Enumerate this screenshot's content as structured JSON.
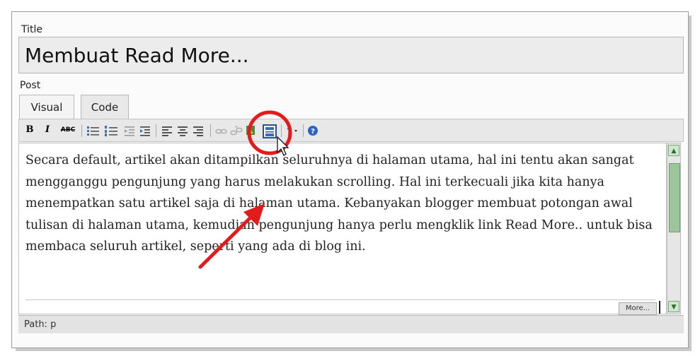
{
  "form": {
    "title_label": "Title",
    "title_value": "Membuat Read More...",
    "post_label": "Post",
    "tabs": [
      {
        "label": "Visual"
      },
      {
        "label": "Code"
      }
    ]
  },
  "toolbar": {
    "bold": "B",
    "italic": "I",
    "strikethrough": "ABC"
  },
  "editor": {
    "content": "Secara default, artikel akan ditampilkan seluruhnya di halaman utama, hal ini tentu akan sangat mengganggu pengunjung yang harus melakukan scrolling. Hal ini terkecuali jika kita hanya menempatkan satu artikel saja di halaman utama. Kebanyakan blogger membuat potongan awal tulisan di halaman utama, kemudian pengunjung hanya perlu mengklik link Read More.. untuk bisa membaca seluruh artikel, seperti yang ada di blog ini.",
    "more_marker": "More...",
    "path_label": "Path: p"
  },
  "colors": {
    "annotation": "#e31b1b",
    "help_icon": "#2f62c9",
    "scrollbar": "#9cc59c"
  }
}
